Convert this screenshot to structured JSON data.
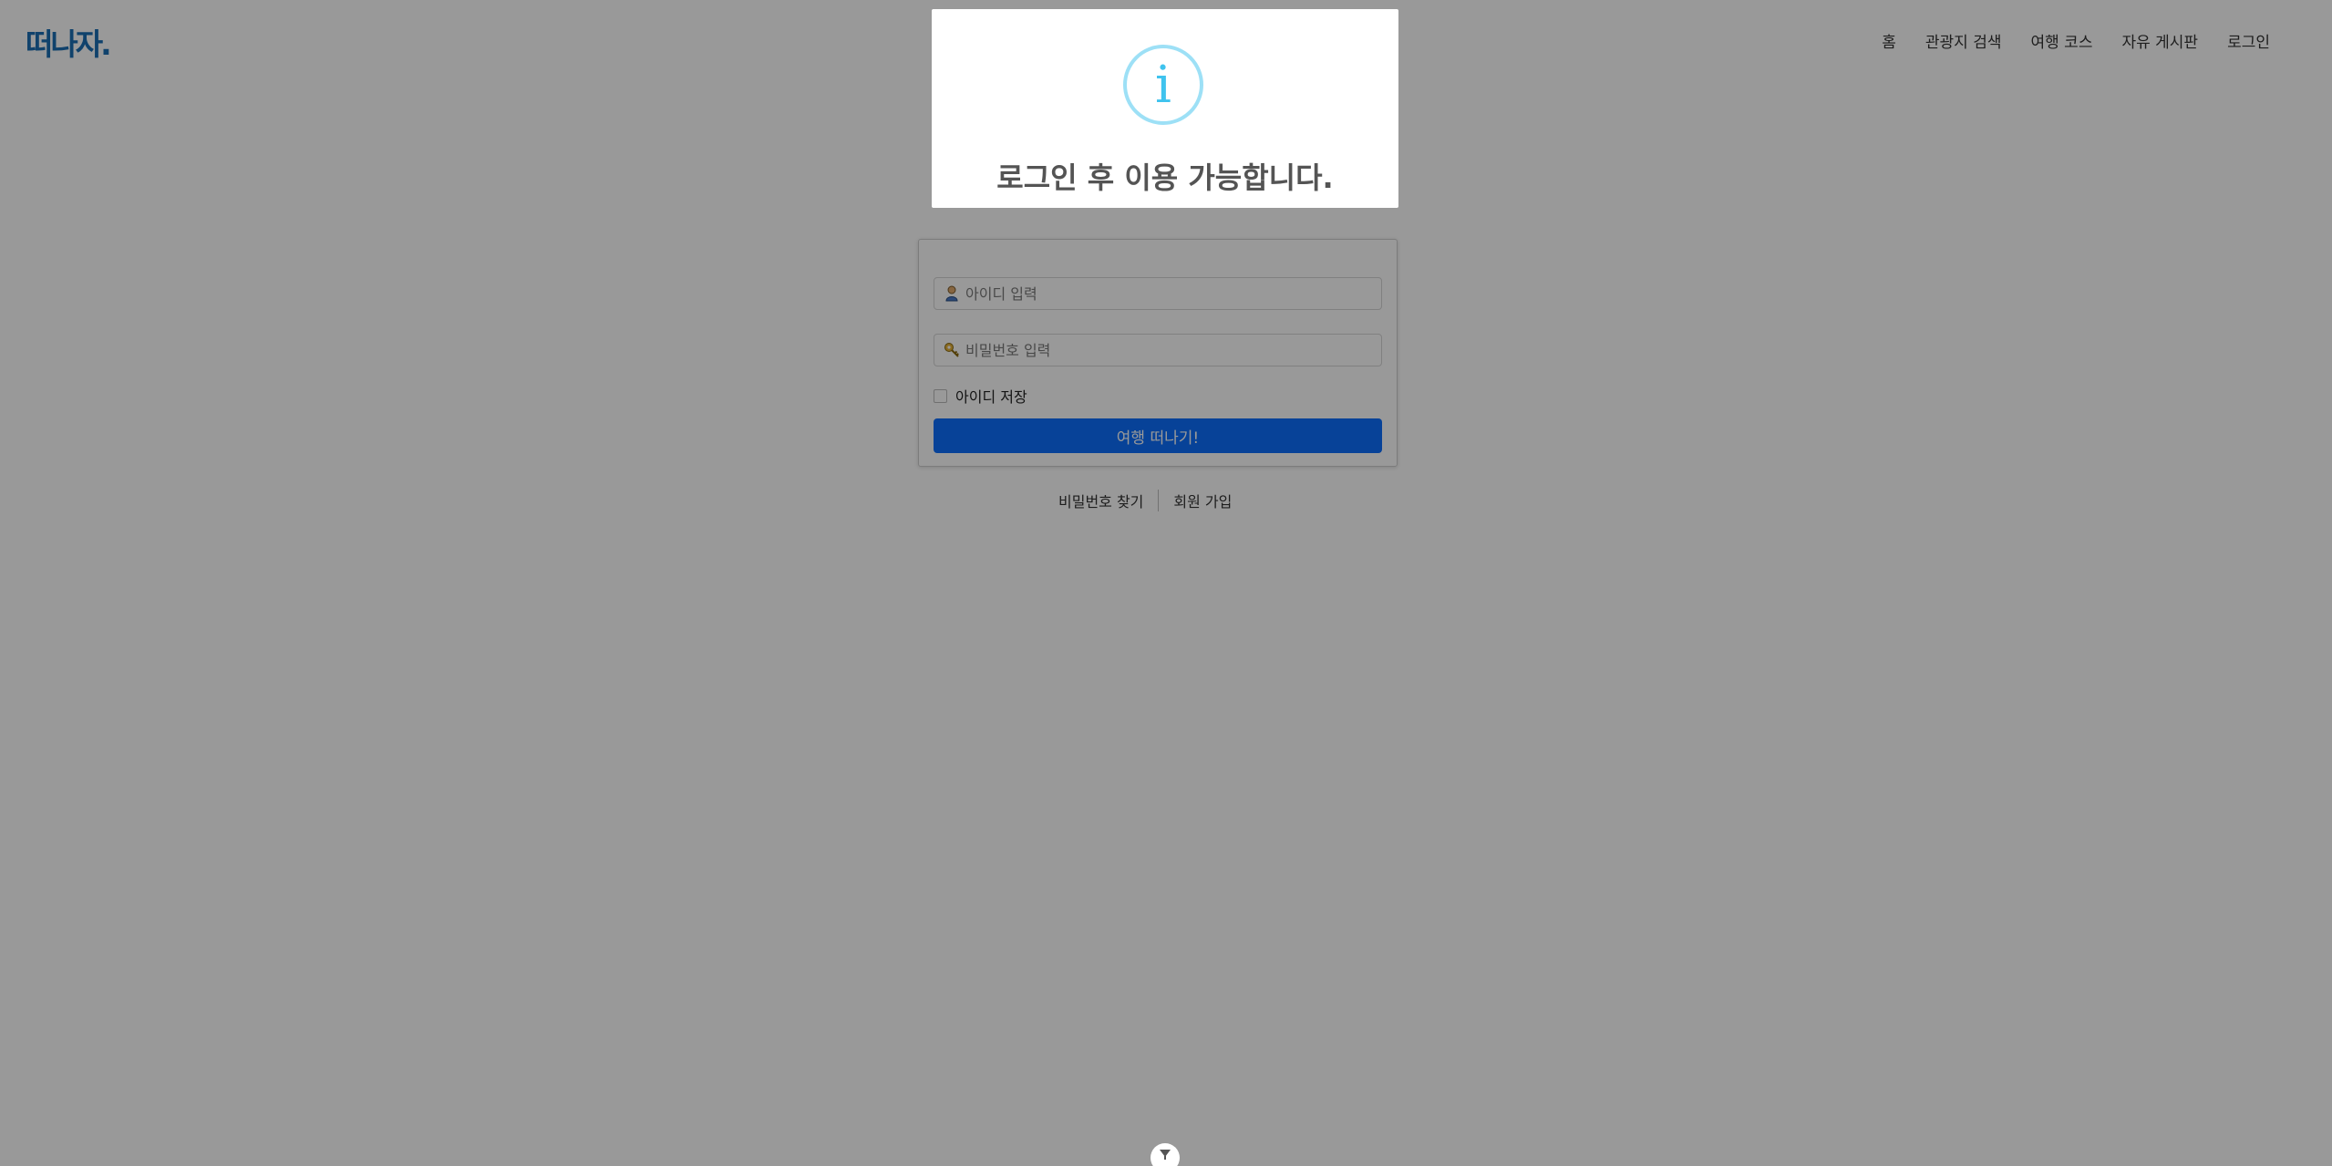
{
  "header": {
    "logo_text": "떠나자.",
    "logo_subtext": "",
    "nav": [
      {
        "label": "홈"
      },
      {
        "label": "관광지 검색"
      },
      {
        "label": "여행 코스"
      },
      {
        "label": "자유 게시판"
      },
      {
        "label": "로그인"
      }
    ]
  },
  "login_form": {
    "id_placeholder": "아이디 입력",
    "password_placeholder": "비밀번호 입력",
    "remember_label": "아이디 저장",
    "remember_checked": false,
    "submit_label": "여행 떠나기!"
  },
  "links": {
    "find_password": "비밀번호 찾기",
    "sign_up": "회원 가입"
  },
  "dialog": {
    "icon": "info-icon",
    "icon_glyph": "i",
    "message": "로그인 후 이용 가능합니다."
  },
  "colors": {
    "brand": "#1c6fb4",
    "primary_button": "#0d6efd",
    "info_ring": "#9de0f6",
    "info_glyph": "#3fc3ee",
    "overlay": "rgba(0,0,0,0.4)"
  }
}
